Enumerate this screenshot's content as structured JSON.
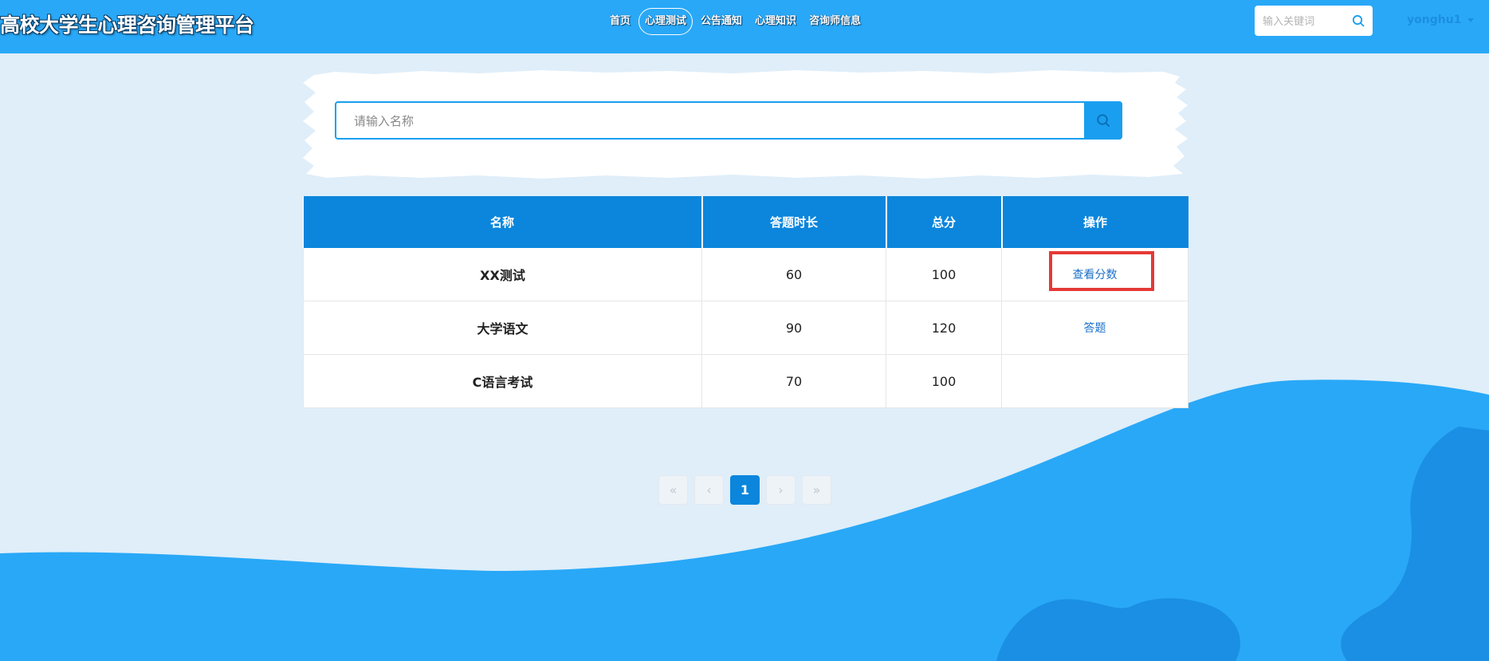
{
  "header": {
    "brand": "高校大学生心理咨询管理平台",
    "nav": [
      {
        "label": "首页",
        "active": false
      },
      {
        "label": "心理测试",
        "active": true
      },
      {
        "label": "公告通知",
        "active": false
      },
      {
        "label": "心理知识",
        "active": false
      },
      {
        "label": "咨询师信息",
        "active": false
      }
    ],
    "search": {
      "placeholder": "输入关键词",
      "value": "",
      "icon": "search-icon"
    },
    "user": {
      "name": "yonghu1",
      "icon": "caret-down-icon"
    }
  },
  "main_search": {
    "placeholder": "请输入名称",
    "value": "",
    "icon": "search-icon"
  },
  "table": {
    "headers": [
      "名称",
      "答题时长",
      "总分",
      "操作"
    ],
    "rows": [
      {
        "name": "XX测试",
        "duration": "60",
        "total": "100",
        "action": "查看分数"
      },
      {
        "name": "大学语文",
        "duration": "90",
        "total": "120",
        "action": "答题"
      },
      {
        "name": "C语言考试",
        "duration": "70",
        "total": "100",
        "action": ""
      }
    ]
  },
  "pagination": {
    "first": "«",
    "prev": "‹",
    "current": "1",
    "next": "›",
    "last": "»"
  },
  "colors": {
    "header_bg": "#29a8f7",
    "primary": "#0b86dc",
    "page_bg": "#dfeef9",
    "highlight": "#e53935"
  }
}
